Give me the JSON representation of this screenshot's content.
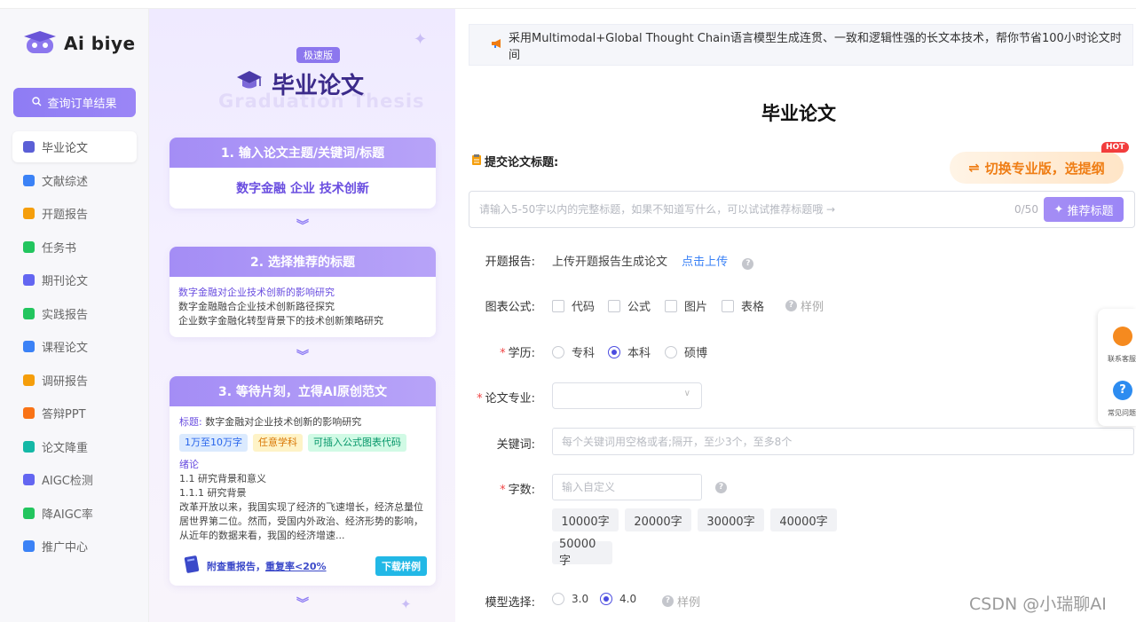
{
  "brand": {
    "name": "Ai biye"
  },
  "sidebar": {
    "query_button": "查询订单结果",
    "items": [
      {
        "label": "毕业论文",
        "icon": "graduation-cap-icon",
        "color": "#5b5fd6",
        "active": true
      },
      {
        "label": "文献综述",
        "icon": "book-icon",
        "color": "#3b82f6"
      },
      {
        "label": "开题报告",
        "icon": "report-icon",
        "color": "#f59e0b"
      },
      {
        "label": "任务书",
        "icon": "task-icon",
        "color": "#22c55e"
      },
      {
        "label": "期刊论文",
        "icon": "journal-icon",
        "color": "#6366f1"
      },
      {
        "label": "实践报告",
        "icon": "practice-icon",
        "color": "#22c55e"
      },
      {
        "label": "课程论文",
        "icon": "course-icon",
        "color": "#3b82f6"
      },
      {
        "label": "调研报告",
        "icon": "survey-icon",
        "color": "#f59e0b"
      },
      {
        "label": "答辩PPT",
        "icon": "ppt-icon",
        "color": "#f97316"
      },
      {
        "label": "论文降重",
        "icon": "reduce-icon",
        "color": "#14b8a6"
      },
      {
        "label": "AIGC检测",
        "icon": "detect-icon",
        "color": "#6366f1"
      },
      {
        "label": "降AIGC率",
        "icon": "ai-icon",
        "color": "#22c55e"
      },
      {
        "label": "推广中心",
        "icon": "send-icon",
        "color": "#3b82f6"
      }
    ]
  },
  "promo": {
    "badge": "极速版",
    "title": "毕业论文",
    "ghost": "Graduation Thesis",
    "step1": {
      "title": "1. 输入论文主题/关键词/标题",
      "content": "数字金融 企业 技术创新"
    },
    "step2": {
      "title": "2. 选择推荐的标题",
      "lines": [
        "数字金融对企业技术创新的影响研究",
        "数字金融融合企业技术创新路径探究",
        "企业数字金融化转型背景下的技术创新策略研究"
      ]
    },
    "step3": {
      "title": "3. 等待片刻，立得AI原创范文",
      "title_label": "标题:",
      "title_value": "数字金融对企业技术创新的影响研究",
      "tags": [
        "1万至10万字",
        "任意学科",
        "可插入公式图表代码"
      ],
      "intro": "绪论",
      "sec1": "1.1 研究背景和意义",
      "sec2": "1.1.1 研究背景",
      "para": "改革开放以来，我国实现了经济的飞速增长，经济总量位居世界第二位。然而，受国内外政治、经济形势的影响，从近年的数据来看，我国的经济增速...",
      "foot_text": "附查重报告，",
      "foot_rate": "重复率<20%",
      "download": "下载样例"
    }
  },
  "main": {
    "notice": "采用Multimodal+Global Thought Chain语言模型生成连贯、一致和逻辑性强的长文本技术，帮你节省100小时论文时间",
    "form_title": "毕业论文",
    "submit_label": "提交论文标题:",
    "switch_label": "切换专业版，选提纲",
    "hot": "HOT",
    "title_placeholder": "请输入5-50字以内的完整标题，如果不知道写什么，可以试试推荐标题哦 →",
    "title_counter": "0/50",
    "recommend_button": "推荐标题",
    "proposal": {
      "label": "开题报告:",
      "text": "上传开题报告生成论文",
      "link": "点击上传"
    },
    "charts": {
      "label": "图表公式:",
      "options": [
        "代码",
        "公式",
        "图片",
        "表格"
      ],
      "example": "样例"
    },
    "degree": {
      "label": "学历:",
      "options": [
        "专科",
        "本科",
        "硕博"
      ],
      "selected": "本科"
    },
    "major": {
      "label": "论文专业:"
    },
    "keywords": {
      "label": "关键词:",
      "placeholder": "每个关键词用空格或者;隔开，至少3个，至多8个"
    },
    "wordcount": {
      "label": "字数:",
      "placeholder": "输入自定义",
      "chips": [
        "10000字",
        "20000字",
        "30000字",
        "40000字",
        "50000字"
      ]
    },
    "model": {
      "label": "模型选择:",
      "options": [
        "3.0",
        "4.0"
      ],
      "selected": "4.0",
      "example": "样例"
    }
  },
  "float": {
    "contact": "联系客服",
    "faq": "常见问题"
  },
  "watermark": "CSDN @小瑞聊AI"
}
